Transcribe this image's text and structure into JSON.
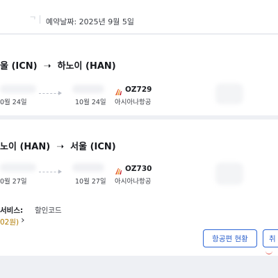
{
  "header": {
    "masked_prefix": "ᄀ",
    "booking_date_label": "예약날짜: 2025년 9월 5일"
  },
  "outbound": {
    "route_title": "울 (ICN)  ➝  하노이 (HAN)",
    "dep_date": "0월 24일",
    "arr_date": "10월 24일",
    "flight_number": "OZ729",
    "airline": "아시아나항공"
  },
  "return": {
    "route_title": "노이 (HAN)  ➝  서울 (ICN)",
    "dep_date": "0월 27일",
    "arr_date": "10월 27일",
    "flight_number": "OZ730",
    "airline": "아시아나항공"
  },
  "services": {
    "label": "서비스:",
    "value": "할인코드",
    "amount": "02원)",
    "chevron": "›"
  },
  "buttons": {
    "flight_status": "항공편 현황",
    "cancel_partial": "취"
  },
  "icons": {
    "airline_logo": "asiana-logo-icon"
  },
  "colors": {
    "primary": "#2a5fcb",
    "amount": "#b07a00",
    "airline_logo": "#e35a2d"
  }
}
